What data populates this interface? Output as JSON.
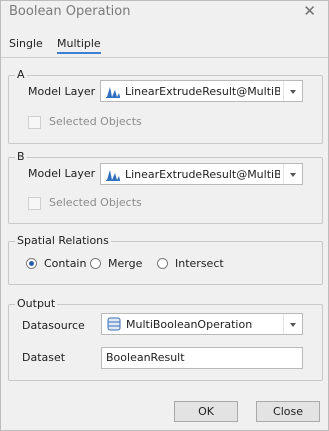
{
  "window": {
    "title": "Boolean Operation",
    "close_glyph": "✕"
  },
  "tabs": [
    {
      "label": "Single"
    },
    {
      "label": "Multiple"
    }
  ],
  "group_a": {
    "legend": "A",
    "model_layer_label": "Model Layer",
    "model_layer_value": "LinearExtrudeResult@MultiBoo",
    "selected_objects_label": "Selected Objects",
    "layer_icon": "model-layer-icon"
  },
  "group_b": {
    "legend": "B",
    "model_layer_label": "Model Layer",
    "model_layer_value": "LinearExtrudeResult@MultiBoo",
    "selected_objects_label": "Selected Objects",
    "layer_icon": "model-layer-icon"
  },
  "spatial_relations": {
    "legend": "Spatial Relations",
    "options": [
      {
        "label": "Contain",
        "checked": true
      },
      {
        "label": "Merge",
        "checked": false
      },
      {
        "label": "Intersect",
        "checked": false
      }
    ]
  },
  "output": {
    "legend": "Output",
    "datasource_label": "Datasource",
    "datasource_value": "MultiBooleanOperation",
    "datasource_icon": "database-icon",
    "dataset_label": "Dataset",
    "dataset_value": "BooleanResult"
  },
  "buttons": {
    "ok": "OK",
    "close": "Close"
  },
  "colors": {
    "accent": "#3c7fd4",
    "window_bg": "#f0f0f0",
    "icon_blue": "#2f6fbf"
  }
}
